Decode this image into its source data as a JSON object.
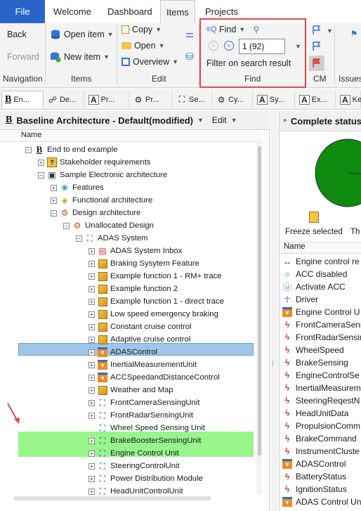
{
  "menu": {
    "file": "File",
    "tabs": [
      "Welcome",
      "Dashboard",
      "Items",
      "Projects"
    ],
    "active_tab": "Items"
  },
  "ribbon": {
    "navigation": {
      "back": "Back",
      "forward": "Forward",
      "label": "Navigation"
    },
    "items": {
      "open_item": "Open item",
      "new_item": "New item",
      "label": "Items"
    },
    "edit": {
      "copy": "Copy",
      "open": "Open",
      "overview": "Overview",
      "label": "Edit"
    },
    "find": {
      "find": "Find",
      "result_value": "1 (92)",
      "filter": "Filter on search result",
      "label": "Find"
    },
    "cm": {
      "label": "CM"
    },
    "issues": {
      "label": "Issues"
    }
  },
  "doc_tabs": [
    "En...",
    "De...",
    "Pr...",
    "Pr...",
    "Se...",
    "Cy...",
    "Sy...",
    "Ex...",
    "Ke..."
  ],
  "left_panel": {
    "title": "Baseline Architecture - Default(modified)",
    "edit": "Edit",
    "column": "Name",
    "tree": [
      {
        "label": "End to end example",
        "icon": "baseline-icon",
        "level": 0
      },
      {
        "label": "Stakeholder requirements",
        "icon": "folder-icon",
        "level": 1
      },
      {
        "label": "Sample Electronic architecture",
        "icon": "camera-icon",
        "level": 1
      },
      {
        "label": "Features",
        "icon": "features-icon",
        "level": 2
      },
      {
        "label": "Functional architecture",
        "icon": "functional-icon",
        "level": 2
      },
      {
        "label": "Design architecture",
        "icon": "design-icon",
        "level": 2
      },
      {
        "label": "Unallocated Design",
        "icon": "design-icon",
        "level": 3
      },
      {
        "label": "ADAS System",
        "icon": "system-icon",
        "level": 4
      },
      {
        "label": "ADAS System Inbox",
        "icon": "inbox-icon",
        "level": 5
      },
      {
        "label": "Braking Sysytem Feature",
        "icon": "cube-icon",
        "level": 5
      },
      {
        "label": "Example function 1 - RM+ trace",
        "icon": "cube-icon",
        "level": 5
      },
      {
        "label": "Example function 2",
        "icon": "cube-icon",
        "level": 5
      },
      {
        "label": "Example function 1 - direct trace",
        "icon": "cube-icon",
        "level": 5
      },
      {
        "label": "Low speed emergency braking",
        "icon": "cube-icon",
        "level": 5
      },
      {
        "label": "Constant cruise control",
        "icon": "cube-icon",
        "level": 5
      },
      {
        "label": "Adaptive cruise control",
        "icon": "cube-icon",
        "level": 5
      },
      {
        "label": "ADASControl",
        "icon": "ecu-icon",
        "level": 5
      },
      {
        "label": "InertialMeasurementUnit",
        "icon": "ecu-icon",
        "level": 5
      },
      {
        "label": "ACCSpeedandDistanceControl",
        "icon": "ecu-icon",
        "level": 5
      },
      {
        "label": "Weather and Map",
        "icon": "cube-icon",
        "level": 5
      },
      {
        "label": "FrontCameraSensingUnit",
        "icon": "network-icon",
        "level": 5
      },
      {
        "label": "FrontRadarSensingUnit",
        "icon": "network-icon",
        "level": 5
      },
      {
        "label": "Wheel Speed Sensing Unit",
        "icon": "network-icon",
        "level": 5
      },
      {
        "label": "BrakeBoosterSensingUnit",
        "icon": "network-icon",
        "level": 5
      },
      {
        "label": "Engine Control Unit",
        "icon": "network-icon",
        "level": 5
      },
      {
        "label": "SteeringControlUnit",
        "icon": "network-icon",
        "level": 5
      },
      {
        "label": "Power Distribution Module",
        "icon": "network-icon",
        "level": 5
      },
      {
        "label": "HeadUnitControlUnit",
        "icon": "network-icon",
        "level": 5
      }
    ]
  },
  "right_panel": {
    "title": "Complete status",
    "freeze": "Freeze selected",
    "freeze_extra": "Th",
    "column": "Name",
    "items": [
      {
        "label": "Engine control re",
        "icon": "arrow-both-icon"
      },
      {
        "label": "ACC disabled",
        "icon": "circle-icon"
      },
      {
        "label": "Activate ACC",
        "icon": "uc-icon"
      },
      {
        "label": "Driver",
        "icon": "actor-icon"
      },
      {
        "label": "Engine Control U",
        "icon": "ecu-icon"
      },
      {
        "label": "FrontCameraSensin",
        "icon": "signal-icon"
      },
      {
        "label": "FrontRadarSensin",
        "icon": "signal-icon"
      },
      {
        "label": "WheelSpeed",
        "icon": "signal-icon"
      },
      {
        "label": "BrakeSensing",
        "icon": "signal-icon"
      },
      {
        "label": "EngineControlSe",
        "icon": "signal-icon"
      },
      {
        "label": "InertialMeasurem",
        "icon": "signal-icon"
      },
      {
        "label": "SteeringReqestN",
        "icon": "signal-icon"
      },
      {
        "label": "HeadUnitData",
        "icon": "signal-icon"
      },
      {
        "label": "PropulsionComm",
        "icon": "signal-icon"
      },
      {
        "label": "BrakeCommand",
        "icon": "signal-icon"
      },
      {
        "label": "InstrumentCluste",
        "icon": "signal-icon"
      },
      {
        "label": "ADASControl",
        "icon": "ecu-icon"
      },
      {
        "label": "BatteryStatus",
        "icon": "signal-icon"
      },
      {
        "label": "IgnitionStatus",
        "icon": "signal-icon"
      },
      {
        "label": "ADAS Control Un",
        "icon": "ecu-icon"
      }
    ]
  },
  "colors": {
    "file_blue": "#2b64c8",
    "find_highlight": "#e0474c",
    "selected_row": "#9fc5ea",
    "green_rows": "#98f58c",
    "pie": "#0e8a0e"
  }
}
